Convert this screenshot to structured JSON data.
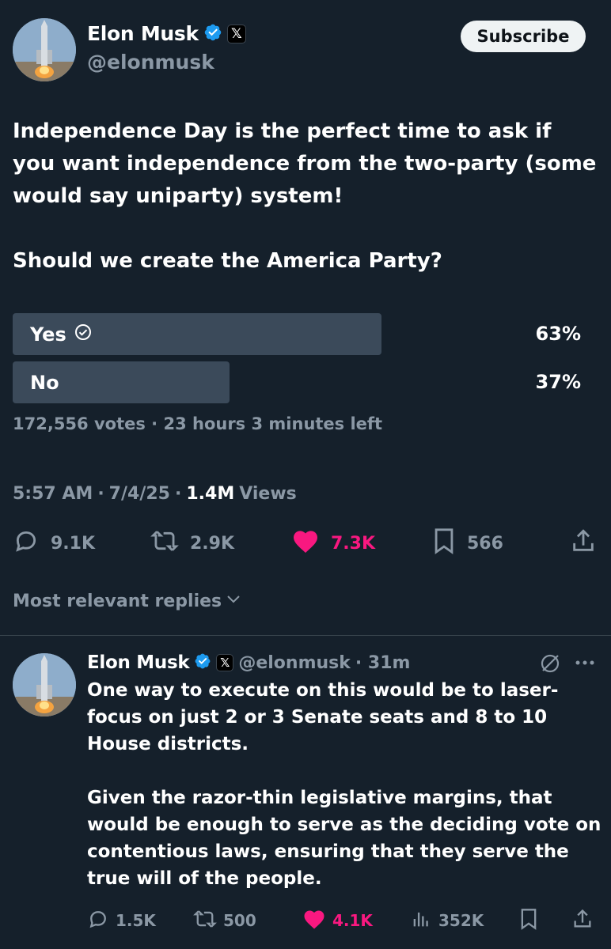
{
  "post": {
    "author_name": "Elon Musk",
    "author_handle": "@elonmusk",
    "x_badge": "𝕏",
    "subscribe_label": "Subscribe",
    "text": "Independence Day is the perfect time to ask if you want independence from the two-party (some would say uniparty) system!\n\nShould we create the America Party?",
    "poll": {
      "options": [
        {
          "label": "Yes",
          "percent_text": "63%",
          "fraction": 0.63,
          "selected": true
        },
        {
          "label": "No",
          "percent_text": "37%",
          "fraction": 0.37,
          "selected": false
        }
      ],
      "summary": "172,556 votes · 23 hours 3 minutes left"
    },
    "time": "5:57 AM",
    "date": "7/4/25",
    "views_count": "1.4M",
    "views_label": "Views",
    "separator": "·",
    "actions": {
      "replies": "9.1K",
      "reposts": "2.9K",
      "likes": "7.3K",
      "bookmarks": "566"
    }
  },
  "replies_sort": {
    "label": "Most relevant replies"
  },
  "reply": {
    "author_name": "Elon Musk",
    "x_badge": "𝕏",
    "author_handle": "@elonmusk",
    "age": "· 31m",
    "text": "One way to execute on this would be to laser-\nfocus on just 2 or 3 Senate seats and 8 to 10\nHouse districts.\n\nGiven the razor-thin legislative margins, that\nwould be enough to serve as the deciding vote on\ncontentious laws, ensuring that they serve the\ntrue will of the people.",
    "actions": {
      "replies": "1.5K",
      "reposts": "500",
      "likes": "4.1K",
      "views": "352K"
    }
  },
  "colors": {
    "background": "#15202b",
    "text": "#ffffff",
    "muted": "#8b98a5",
    "like_pink": "#f91880",
    "verified_blue": "#1d9bf0",
    "poll_bar": "#3b4a5a"
  },
  "icons": [
    "verified-badge-icon",
    "x-logo-icon",
    "check-circle-icon",
    "reply-icon",
    "repost-icon",
    "heart-icon",
    "bookmark-icon",
    "share-icon",
    "chevron-down-icon",
    "grok-icon",
    "more-icon",
    "views-icon"
  ]
}
